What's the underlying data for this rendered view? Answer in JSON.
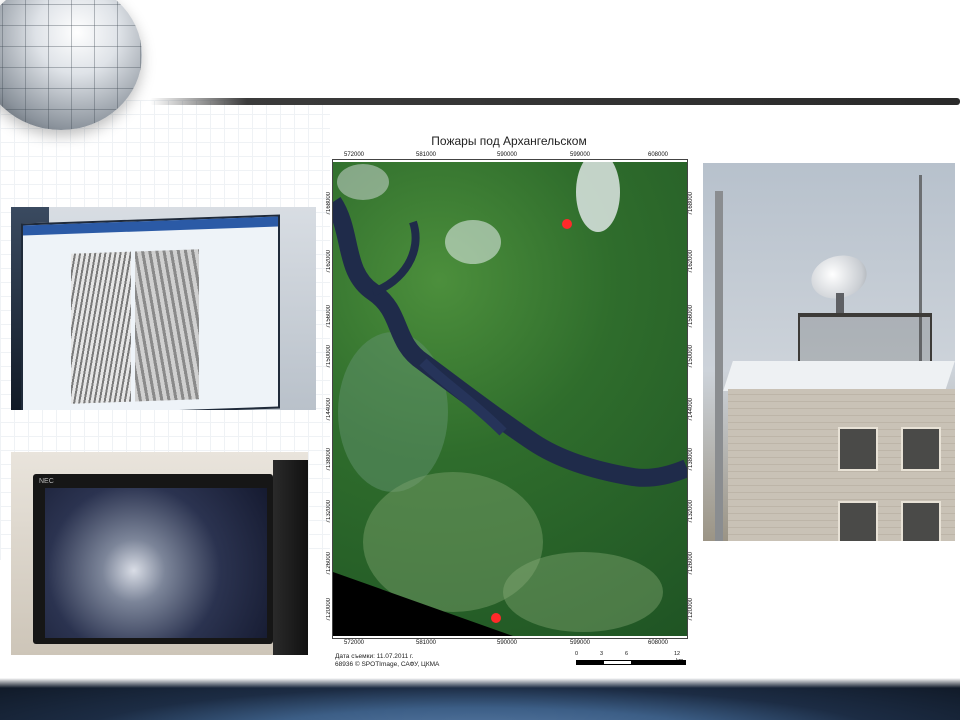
{
  "map": {
    "title": "Пожары под Архангельском",
    "x_ticks": [
      "572000",
      "581000",
      "590000",
      "599000",
      "608000"
    ],
    "y_ticks": [
      "7168000",
      "7162000",
      "7156000",
      "7150000",
      "7144000",
      "7138000",
      "7132000",
      "7126000",
      "7120000"
    ],
    "caption_line1": "Дата съемки: 11.07.2011 г.",
    "caption_line2": "68936 © SPOTImage, САФУ, ЦКМА",
    "scale_labels": [
      "0",
      "3",
      "6",
      "12"
    ],
    "scale_unit": "km",
    "fire_marker_color": "#ff2a2a",
    "river_color": "#1f2b4a"
  },
  "photos": {
    "monitor_bottom_brand": "NEC"
  }
}
